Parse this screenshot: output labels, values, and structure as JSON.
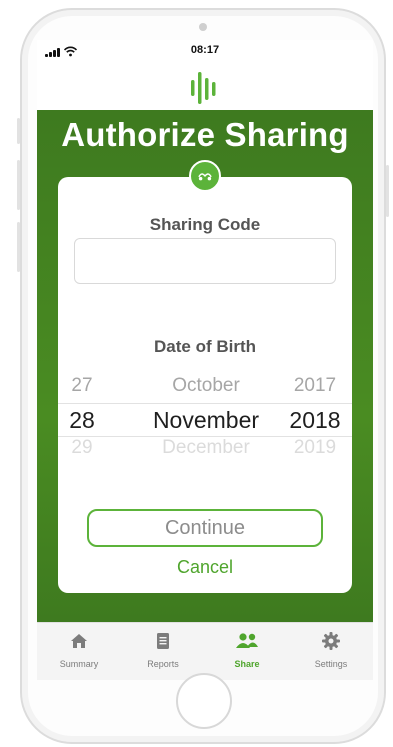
{
  "status_bar": {
    "time": "08:17"
  },
  "page": {
    "title": "Authorize Sharing"
  },
  "form": {
    "sharing_code_label": "Sharing Code",
    "sharing_code_value": "",
    "dob_label": "Date of Birth",
    "picker": {
      "prev": {
        "day": "27",
        "month": "October",
        "year": "2017"
      },
      "selected": {
        "day": "28",
        "month": "November",
        "year": "2018"
      },
      "next": {
        "day": "29",
        "month": "December",
        "year": "2019"
      }
    },
    "continue_label": "Continue",
    "cancel_label": "Cancel"
  },
  "tab_bar": {
    "items": [
      {
        "label": "Summary",
        "icon": "home-icon",
        "active": false
      },
      {
        "label": "Reports",
        "icon": "document-icon",
        "active": false
      },
      {
        "label": "Share",
        "icon": "people-icon",
        "active": true
      },
      {
        "label": "Settings",
        "icon": "gear-icon",
        "active": false
      }
    ]
  },
  "colors": {
    "brand_green": "#4a8c22",
    "accent_green": "#5cb33a",
    "link_green": "#4fa52d"
  }
}
